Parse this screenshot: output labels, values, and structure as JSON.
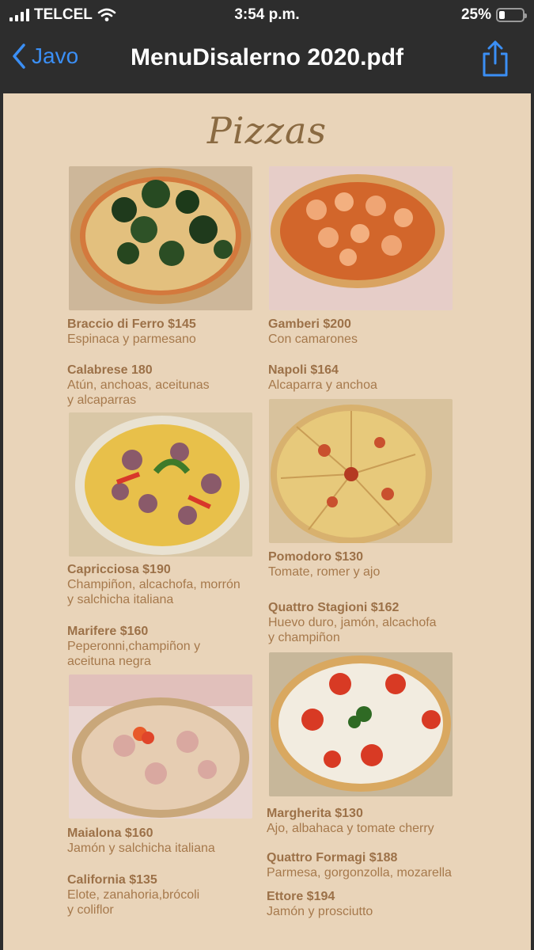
{
  "status_bar": {
    "carrier": "TELCEL",
    "time": "3:54 p.m.",
    "battery": "25%",
    "battery_level": 0.25
  },
  "nav": {
    "back_label": "Javo",
    "title": "MenuDisalerno 2020.pdf",
    "share_icon": "share-icon"
  },
  "menu": {
    "heading": "Pizzas",
    "items": [
      {
        "name": "Braccio di Ferro  $145",
        "desc": "Espinaca y parmesano"
      },
      {
        "name": "Gamberi   $200",
        "desc": "Con camarones"
      },
      {
        "name": "Calabrese  180",
        "desc": "Atún, anchoas, aceitunas\ny alcaparras"
      },
      {
        "name": "Napoli   $164",
        "desc": "Alcaparra y anchoa"
      },
      {
        "name": "Capricciosa   $190",
        "desc": "Champiñon, alcachofa, morrón\ny salchicha italiana"
      },
      {
        "name": "Pomodoro    $130",
        "desc": "Tomate, romer y ajo"
      },
      {
        "name": "Marifere  $160",
        "desc": "Peperonni,champiñon y\naceituna negra"
      },
      {
        "name": "Quattro Stagioni  $162",
        "desc": "Huevo duro, jamón, alcachofa\ny champiñon"
      },
      {
        "name": "Maialona  $160",
        "desc": "Jamón y salchicha italiana"
      },
      {
        "name": "Margherita  $130",
        "desc": "Ajo, albahaca y tomate cherry"
      },
      {
        "name": "California  $135",
        "desc": "Elote, zanahoria,brócoli\ny coliflor"
      },
      {
        "name": "Quattro Formagi  $188",
        "desc": "Parmesa, gorgonzolla, mozarella"
      },
      {
        "name": "Ettore  $194",
        "desc": "Jamón y prosciutto"
      }
    ]
  },
  "colors": {
    "page_bg": "#e9d4b9",
    "text": "#a6794c",
    "accent_blue": "#3b8ff5",
    "bar_bg": "#2d2d2d"
  }
}
